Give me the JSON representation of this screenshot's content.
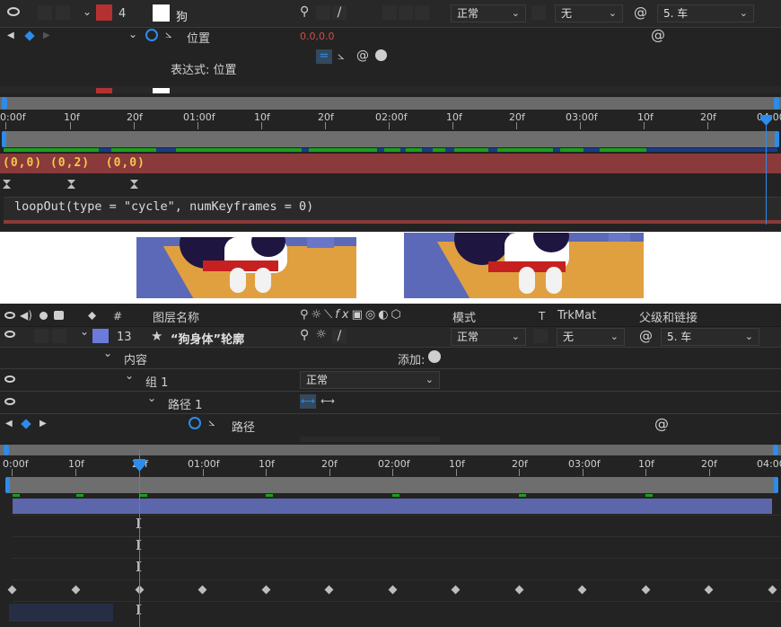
{
  "top": {
    "layer_num": "4",
    "layer_name": "狗",
    "mode": "正常",
    "trkmat": "无",
    "parent": "5. 车",
    "prop_name": "位置",
    "prop_value": "0.0,0.0",
    "expr_label": "表达式: 位置",
    "ruler_ticks": [
      "0:00f",
      "10f",
      "20f",
      "01:00f",
      "10f",
      "20f",
      "02:00f",
      "10f",
      "20f",
      "03:00f",
      "10f",
      "20f",
      "04:00"
    ],
    "value_line": "(0,0) (0,2)  (0,0)",
    "expression": "loopOut(type = \"cycle\", numKeyframes = 0)"
  },
  "bottom": {
    "headers": {
      "name": "图层名称",
      "mode": "模式",
      "t": "T",
      "trkmat": "TrkMat",
      "parent": "父级和链接",
      "hash": "#"
    },
    "layer_num": "13",
    "layer_name": "“狗身体”轮廓",
    "mode": "正常",
    "trkmat": "无",
    "parent": "5. 车",
    "content": "内容",
    "add": "添加:",
    "group": "组 1",
    "group_mode": "正常",
    "path_group": "路径 1",
    "path_prop": "路径",
    "ruler_ticks": [
      "0:00f",
      "10f",
      "20f",
      "01:00f",
      "10f",
      "20f",
      "02:00f",
      "10f",
      "20f",
      "03:00f",
      "10f",
      "20f",
      "04:00"
    ]
  },
  "colors": {
    "panel": "#232323",
    "accent": "#2d8ceb",
    "label_red": "#b53131",
    "label_blue": "#6b7bd9",
    "expr_bar": "#8a3a3a",
    "value_text": "#f2c94c"
  }
}
